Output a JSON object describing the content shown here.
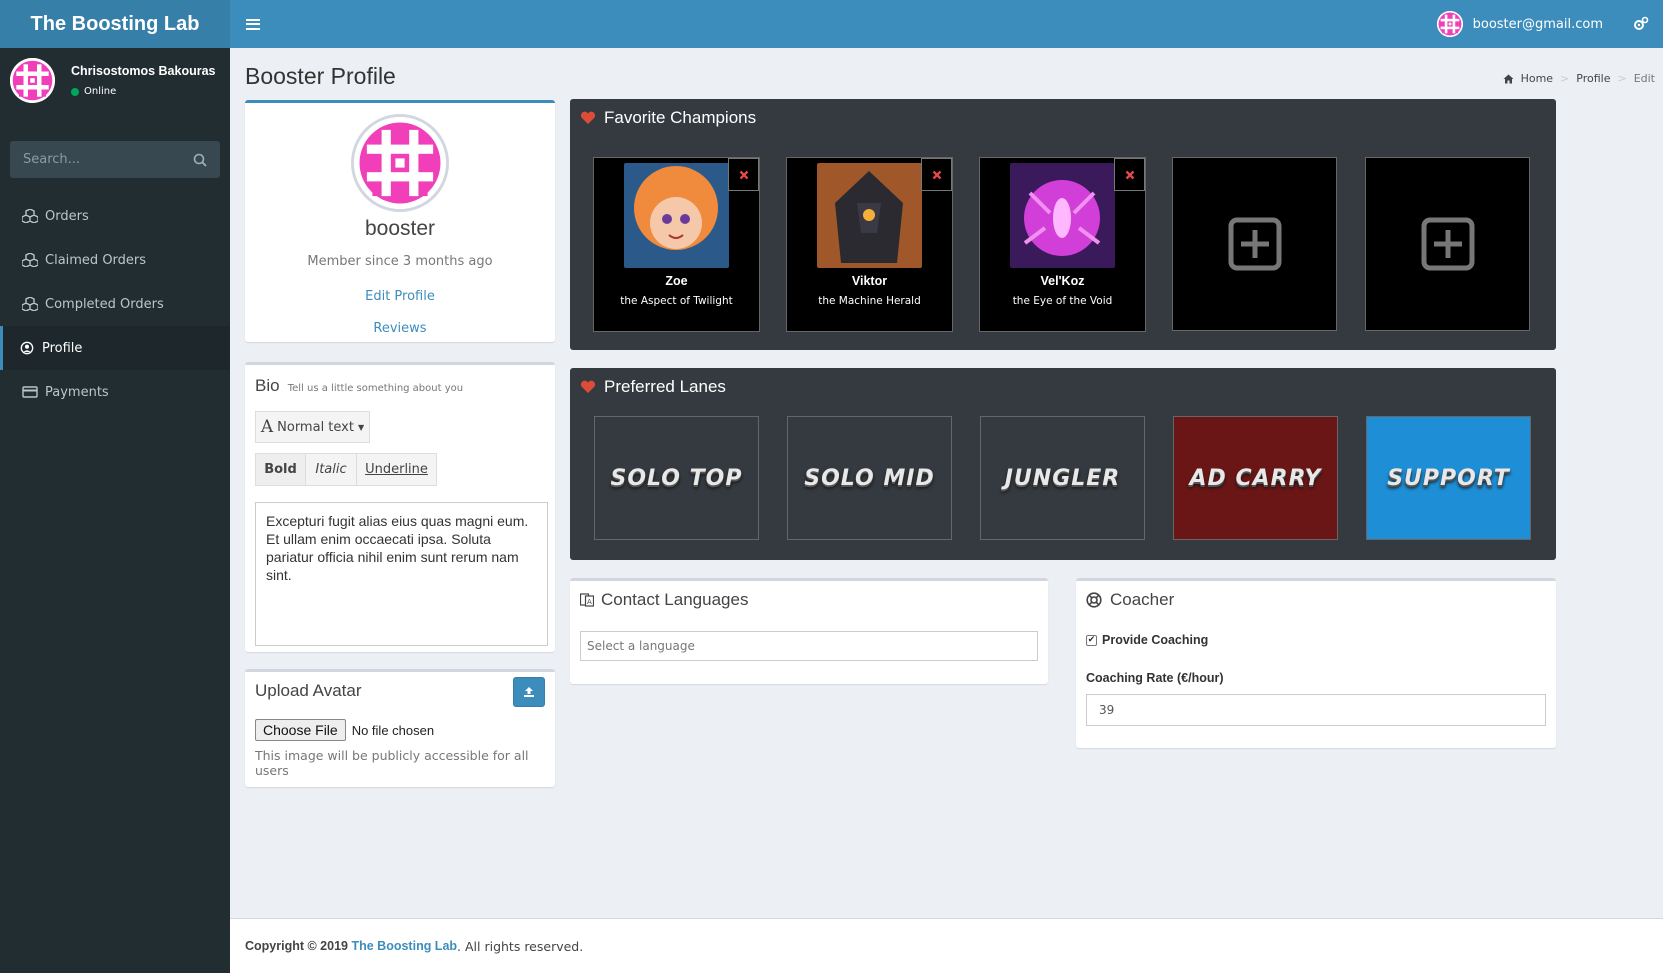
{
  "app": {
    "logo": "The Boosting Lab",
    "user_email": "booster@gmail.com"
  },
  "sidebar": {
    "user_name": "Chrisostomos Bakouras",
    "status": "Online",
    "search_placeholder": "Search...",
    "items": [
      {
        "label": "Orders",
        "icon": "cubes-icon"
      },
      {
        "label": "Claimed Orders",
        "icon": "cubes-icon"
      },
      {
        "label": "Completed Orders",
        "icon": "cubes-icon"
      },
      {
        "label": "Profile",
        "icon": "user-circle-icon",
        "active": true
      },
      {
        "label": "Payments",
        "icon": "credit-card-icon"
      }
    ]
  },
  "page": {
    "title": "Booster Profile",
    "breadcrumb": [
      "Home",
      "Profile",
      "Edit"
    ]
  },
  "profile": {
    "name": "booster",
    "member_since": "Member since 3 months ago",
    "edit_link": "Edit Profile",
    "reviews_link": "Reviews"
  },
  "bio": {
    "title": "Bio",
    "subtitle": "Tell us a little something about you",
    "format_label": "Normal text",
    "bold": "Bold",
    "italic": "Italic",
    "underline": "Underline",
    "text": "Excepturi fugit alias eius quas magni eum. Et ullam enim occaecati ipsa. Soluta pariatur officia nihil enim sunt rerum nam sint."
  },
  "upload": {
    "title": "Upload Avatar",
    "choose": "Choose File",
    "no_file": "No file chosen",
    "help": "This image will be publicly accessible for all users"
  },
  "champions": {
    "title": "Favorite Champions",
    "list": [
      {
        "name": "Zoe",
        "title": "the Aspect of Twilight",
        "color1": "#f08a3c",
        "color2": "#2b5a8a"
      },
      {
        "name": "Viktor",
        "title": "the Machine Herald",
        "color1": "#a0582a",
        "color2": "#2a2a30"
      },
      {
        "name": "Vel'Koz",
        "title": "the Eye of the Void",
        "color1": "#d23fd8",
        "color2": "#3a1a5a"
      }
    ],
    "empty_slots": 2
  },
  "lanes": {
    "title": "Preferred Lanes",
    "list": [
      {
        "label": "SOLO TOP",
        "bg": "#343a40"
      },
      {
        "label": "SOLO MID",
        "bg": "#343a40"
      },
      {
        "label": "JUNGLER",
        "bg": "#343a40"
      },
      {
        "label": "AD CARRY",
        "bg": "#6b1616"
      },
      {
        "label": "SUPPORT",
        "bg": "#1e8fd6"
      }
    ]
  },
  "languages": {
    "title": "Contact Languages",
    "placeholder": "Select a language"
  },
  "coacher": {
    "title": "Coacher",
    "checkbox_label": "Provide Coaching",
    "rate_label": "Coaching Rate (€/hour)",
    "rate_value": "39"
  },
  "footer": {
    "prefix": "Copyright © 2019",
    "brand": "The Boosting Lab",
    "suffix": ". All rights reserved."
  },
  "colors": {
    "primary": "#3c8dbc",
    "sidebar": "#222d32",
    "dark_box": "#343a40",
    "heart": "#dd4b39"
  }
}
